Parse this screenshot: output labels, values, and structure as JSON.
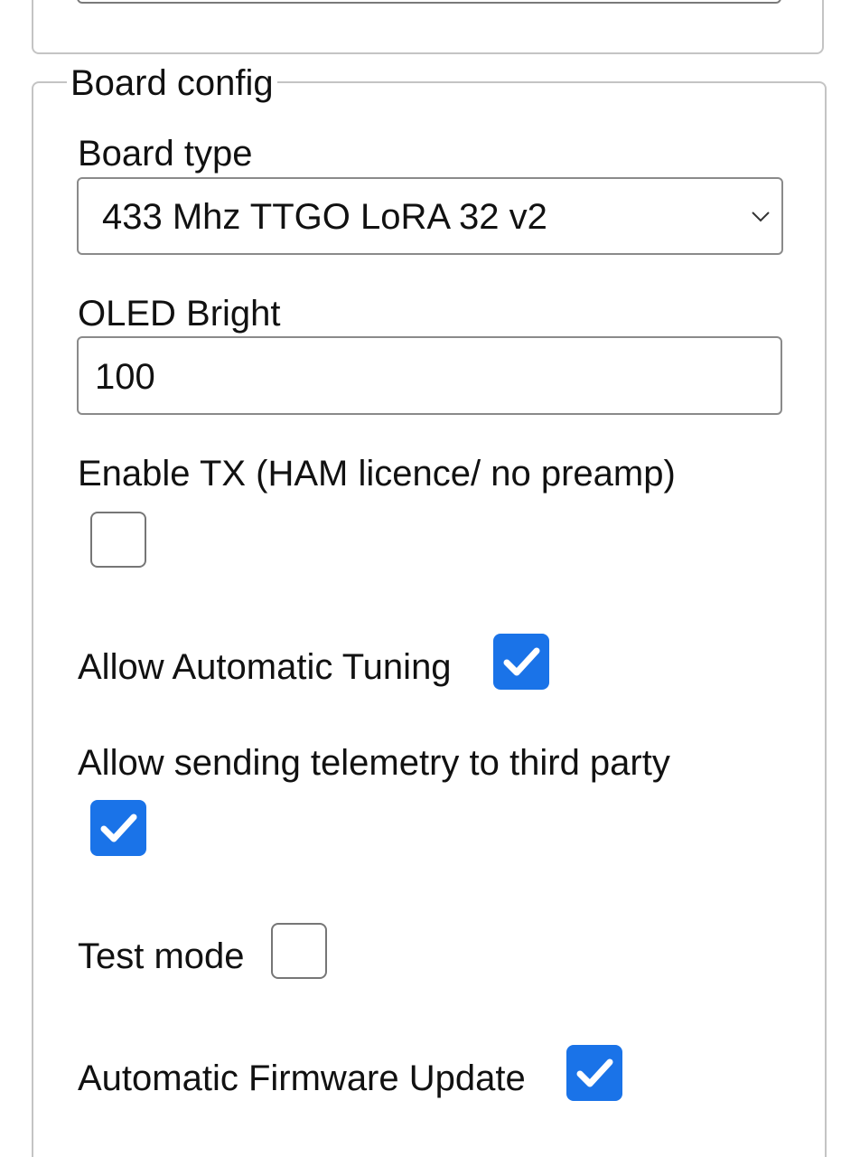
{
  "board_config": {
    "legend": "Board config",
    "board_type": {
      "label": "Board type",
      "selected": "433 Mhz TTGO LoRA 32 v2"
    },
    "oled_bright": {
      "label": "OLED Bright",
      "value": "100"
    },
    "enable_tx": {
      "label": "Enable TX (HAM licence/ no preamp)",
      "checked": false
    },
    "auto_tuning": {
      "label": "Allow Automatic Tuning",
      "checked": true
    },
    "telemetry": {
      "label": "Allow sending telemetry to third party",
      "checked": true
    },
    "test_mode": {
      "label": "Test mode",
      "checked": false
    },
    "auto_firmware": {
      "label": "Automatic Firmware Update",
      "checked": true
    }
  },
  "colors": {
    "accent": "#1a73e8",
    "border": "#c4c4c4"
  },
  "icons": {
    "select_arrow": "chevron-down-icon",
    "check": "checkmark-icon"
  }
}
